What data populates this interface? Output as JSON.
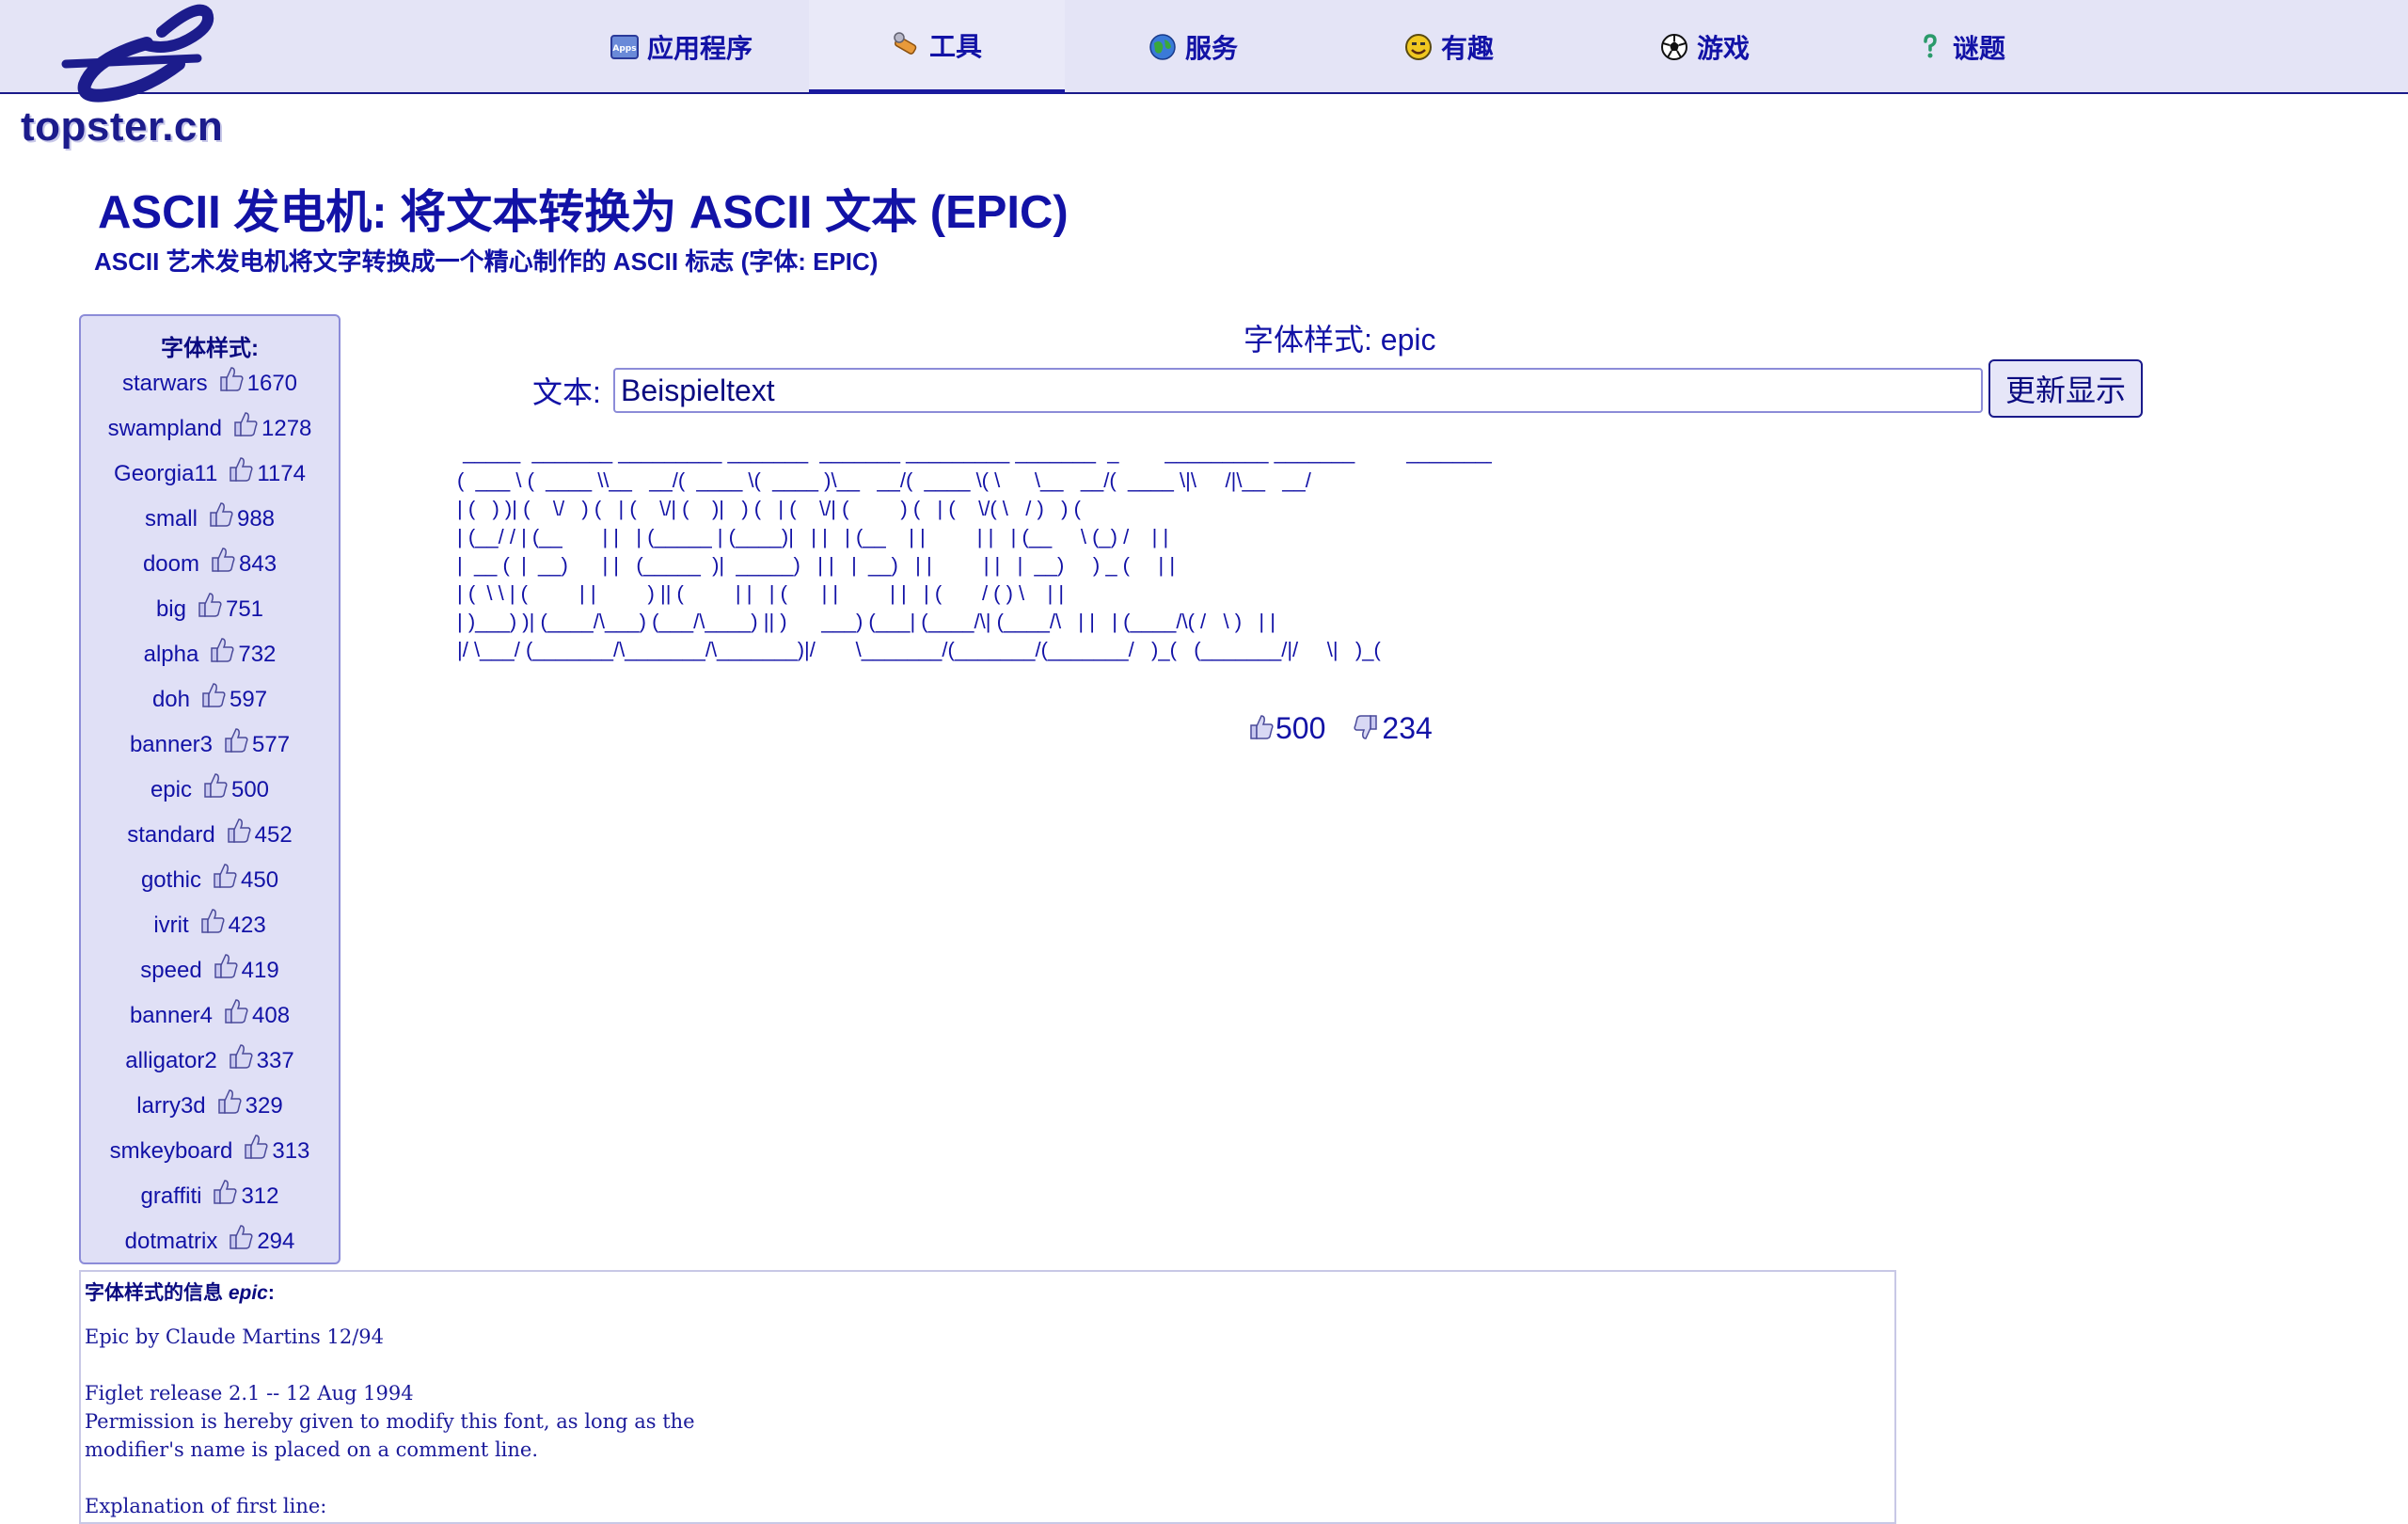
{
  "site": {
    "logo_text": "topster.cn"
  },
  "nav": [
    {
      "label": "应用程序",
      "icon": "apps-icon",
      "active": false
    },
    {
      "label": "工具",
      "icon": "tools-icon",
      "active": true
    },
    {
      "label": "服务",
      "icon": "globe-icon",
      "active": false
    },
    {
      "label": "有趣",
      "icon": "smiley-icon",
      "active": false
    },
    {
      "label": "游戏",
      "icon": "soccer-ball-icon",
      "active": false
    },
    {
      "label": "谜题",
      "icon": "puzzle-icon",
      "active": false
    }
  ],
  "page": {
    "title": "ASCII 发电机: 将文本转换为 ASCII 文本 (EPIC)",
    "subtitle": "ASCII 艺术发电机将文字转换成一个精心制作的 ASCII 标志 (字体: EPIC)"
  },
  "sidebar": {
    "title": "字体样式:",
    "fonts": [
      {
        "name": "starwars",
        "count": "1670"
      },
      {
        "name": "swampland",
        "count": "1278"
      },
      {
        "name": "Georgia11",
        "count": "1174"
      },
      {
        "name": "small",
        "count": "988"
      },
      {
        "name": "doom",
        "count": "843"
      },
      {
        "name": "big",
        "count": "751"
      },
      {
        "name": "alpha",
        "count": "732"
      },
      {
        "name": "doh",
        "count": "597"
      },
      {
        "name": "banner3",
        "count": "577"
      },
      {
        "name": "epic",
        "count": "500"
      },
      {
        "name": "standard",
        "count": "452"
      },
      {
        "name": "gothic",
        "count": "450"
      },
      {
        "name": "ivrit",
        "count": "423"
      },
      {
        "name": "speed",
        "count": "419"
      },
      {
        "name": "banner4",
        "count": "408"
      },
      {
        "name": "alligator2",
        "count": "337"
      },
      {
        "name": "larry3d",
        "count": "329"
      },
      {
        "name": "smkeyboard",
        "count": "313"
      },
      {
        "name": "graffiti",
        "count": "312"
      },
      {
        "name": "dotmatrix",
        "count": "294"
      }
    ]
  },
  "main": {
    "font_label": "字体样式: epic",
    "text_label": "文本:",
    "text_value": "Beispieltext",
    "update_label": "更新显示",
    "ascii_art": " _____  _______ _________ _______  _______ _________ _______  _        _________ _______         _________\n(  ___ \\ (  ____ \\\\__   __/(  ____ \\(  ____ )\\__   __/(  ____ \\( \\      \\__   __/(  ____ \\|\\     /|\\__   __/\n| (   ) )| (    \\/   ) (   | (    \\/| (    )|   ) (   | (    \\/| (         ) (   | (    \\/( \\   / )   ) (\n| (__/ / | (__       | |   | (_____ | (____)|   | |   | (__    | |         | |   | (__     \\ (_) /    | |\n|  __ (  |  __)      | |   (_____  )|  _____)   | |   |  __)   | |         | |   |  __)     ) _ (     | |\n| (  \\ \\ | (         | |         ) || (         | |   | (      | |         | |   | (       / ( ) \\    | |\n| )___) )| (____/\\___) (___/\\____) || )      ___) (___| (____/\\| (____/\\   | |   | (____/\\( /   \\ )   | |\n|/ \\___/ (_______/\\_______/\\_______)|/       \\_______/(_______/(_______/   )_(   (_______/|/     \\|   )_(",
    "votes_up": "500",
    "votes_down": "234"
  },
  "info": {
    "title_prefix": "字体样式的信息",
    "title_font": "epic",
    "title_suffix": ":",
    "text": "Epic by Claude Martins 12/94\n\nFiglet release 2.1 -- 12 Aug 1994\nPermission is hereby given to modify this font, as long as the\nmodifier's name is placed on a comment line.\n\nExplanation of first line:"
  }
}
